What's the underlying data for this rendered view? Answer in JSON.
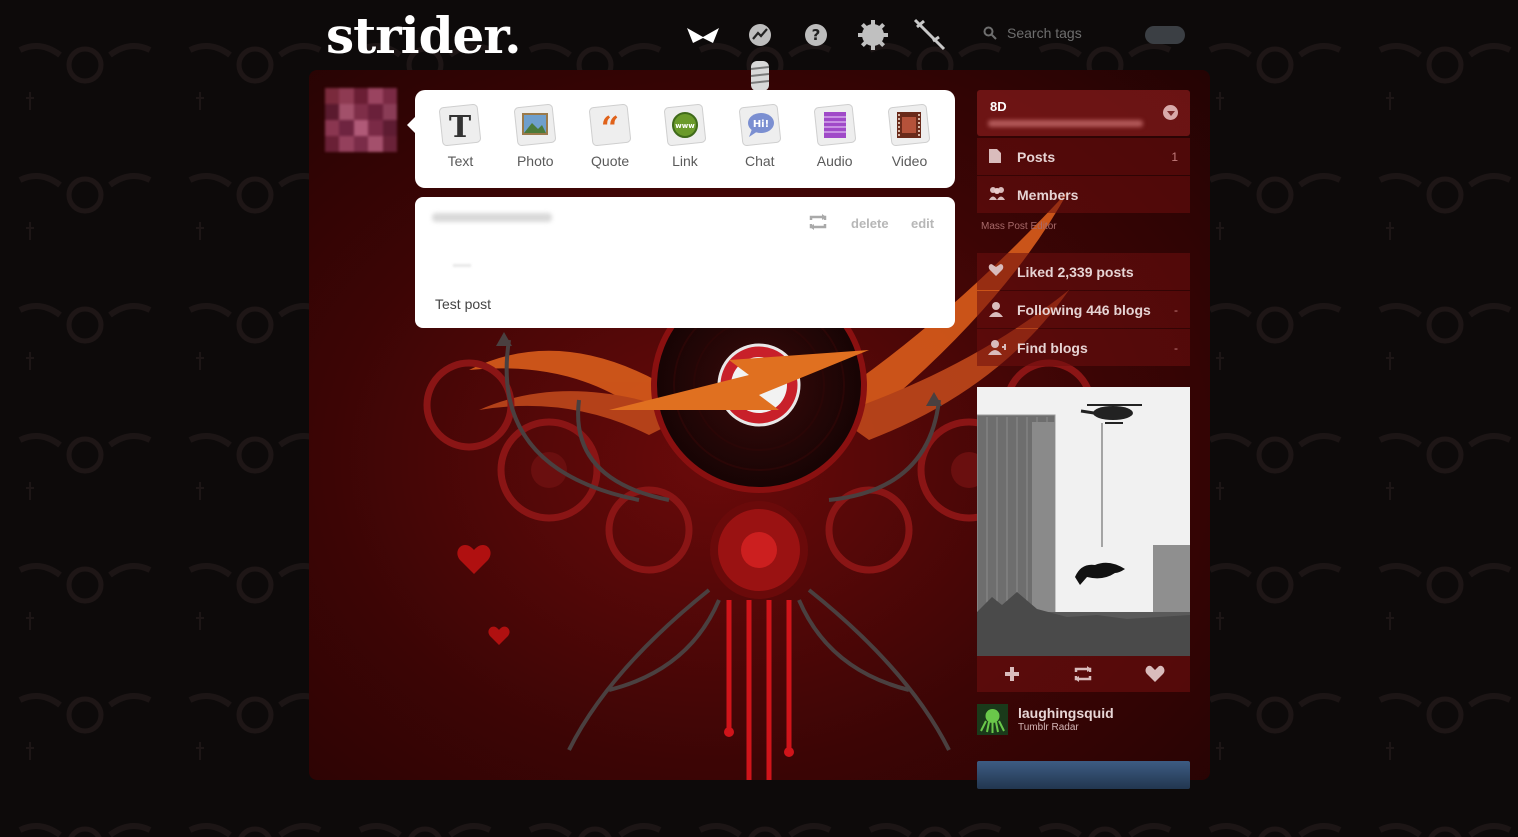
{
  "header": {
    "logo": "strider.",
    "nav_icons": [
      "dashboard-icon",
      "explore-icon",
      "help-icon",
      "settings-icon",
      "logout-icon"
    ],
    "search": {
      "placeholder": "Search tags"
    }
  },
  "post_types": [
    {
      "label": "Text",
      "icon": "text-post-icon"
    },
    {
      "label": "Photo",
      "icon": "photo-post-icon"
    },
    {
      "label": "Quote",
      "icon": "quote-post-icon"
    },
    {
      "label": "Link",
      "icon": "link-post-icon"
    },
    {
      "label": "Chat",
      "icon": "chat-post-icon"
    },
    {
      "label": "Audio",
      "icon": "audio-post-icon"
    },
    {
      "label": "Video",
      "icon": "video-post-icon"
    }
  ],
  "post": {
    "delete_label": "delete",
    "edit_label": "edit",
    "body": "Test post"
  },
  "sidebar": {
    "blog_name": "8D",
    "menu": [
      {
        "label": "Posts",
        "count": "1",
        "icon": "posts-icon"
      },
      {
        "label": "Members",
        "count": "",
        "icon": "members-icon"
      }
    ],
    "mass_post_editor": "Mass Post Editor",
    "activity": [
      {
        "label": "Liked 2,339 posts",
        "icon": "heart-icon"
      },
      {
        "label": "Following 446 blogs",
        "icon": "person-icon"
      },
      {
        "label": "Find blogs",
        "icon": "find-blogs-icon"
      }
    ]
  },
  "radar": {
    "username": "laughingsquid",
    "source": "Tumblr Radar"
  },
  "colors": {
    "panel": "#4a0606",
    "accent_orange": "#e0621a",
    "sidebar_row": "#6e0f0f",
    "card_bg": "#ffffff"
  }
}
